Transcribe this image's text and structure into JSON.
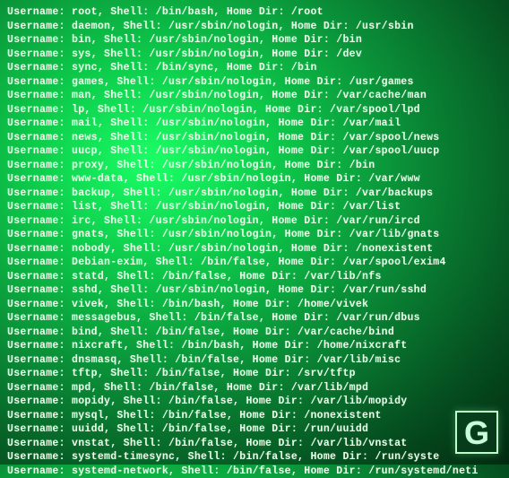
{
  "logo_letter": "G",
  "users": [
    {
      "username": "root",
      "shell": "/bin/bash",
      "home": "/root"
    },
    {
      "username": "daemon",
      "shell": "/usr/sbin/nologin",
      "home": "/usr/sbin"
    },
    {
      "username": "bin",
      "shell": "/usr/sbin/nologin",
      "home": "/bin"
    },
    {
      "username": "sys",
      "shell": "/usr/sbin/nologin",
      "home": "/dev"
    },
    {
      "username": "sync",
      "shell": "/bin/sync",
      "home": "/bin"
    },
    {
      "username": "games",
      "shell": "/usr/sbin/nologin",
      "home": "/usr/games"
    },
    {
      "username": "man",
      "shell": "/usr/sbin/nologin",
      "home": "/var/cache/man"
    },
    {
      "username": "lp",
      "shell": "/usr/sbin/nologin",
      "home": "/var/spool/lpd"
    },
    {
      "username": "mail",
      "shell": "/usr/sbin/nologin",
      "home": "/var/mail"
    },
    {
      "username": "news",
      "shell": "/usr/sbin/nologin",
      "home": "/var/spool/news"
    },
    {
      "username": "uucp",
      "shell": "/usr/sbin/nologin",
      "home": "/var/spool/uucp"
    },
    {
      "username": "proxy",
      "shell": "/usr/sbin/nologin",
      "home": "/bin"
    },
    {
      "username": "www-data",
      "shell": "/usr/sbin/nologin",
      "home": "/var/www"
    },
    {
      "username": "backup",
      "shell": "/usr/sbin/nologin",
      "home": "/var/backups"
    },
    {
      "username": "list",
      "shell": "/usr/sbin/nologin",
      "home": "/var/list"
    },
    {
      "username": "irc",
      "shell": "/usr/sbin/nologin",
      "home": "/var/run/ircd"
    },
    {
      "username": "gnats",
      "shell": "/usr/sbin/nologin",
      "home": "/var/lib/gnats"
    },
    {
      "username": "nobody",
      "shell": "/usr/sbin/nologin",
      "home": "/nonexistent"
    },
    {
      "username": "Debian-exim",
      "shell": "/bin/false",
      "home": "/var/spool/exim4"
    },
    {
      "username": "statd",
      "shell": "/bin/false",
      "home": "/var/lib/nfs"
    },
    {
      "username": "sshd",
      "shell": "/usr/sbin/nologin",
      "home": "/var/run/sshd"
    },
    {
      "username": "vivek",
      "shell": "/bin/bash",
      "home": "/home/vivek"
    },
    {
      "username": "messagebus",
      "shell": "/bin/false",
      "home": "/var/run/dbus"
    },
    {
      "username": "bind",
      "shell": "/bin/false",
      "home": "/var/cache/bind"
    },
    {
      "username": "nixcraft",
      "shell": "/bin/bash",
      "home": "/home/nixcraft"
    },
    {
      "username": "dnsmasq",
      "shell": "/bin/false",
      "home": "/var/lib/misc"
    },
    {
      "username": "tftp",
      "shell": "/bin/false",
      "home": "/srv/tftp"
    },
    {
      "username": "mpd",
      "shell": "/bin/false",
      "home": "/var/lib/mpd"
    },
    {
      "username": "mopidy",
      "shell": "/bin/false",
      "home": "/var/lib/mopidy"
    },
    {
      "username": "mysql",
      "shell": "/bin/false",
      "home": "/nonexistent"
    },
    {
      "username": "uuidd",
      "shell": "/bin/false",
      "home": "/run/uuidd"
    },
    {
      "username": "vnstat",
      "shell": "/bin/false",
      "home": "/var/lib/vnstat"
    },
    {
      "username": "systemd-timesync",
      "shell": "/bin/false",
      "home": "/run/syste"
    },
    {
      "username": "systemd-network",
      "shell": "/bin/false",
      "home": "/run/systemd/neti"
    }
  ]
}
